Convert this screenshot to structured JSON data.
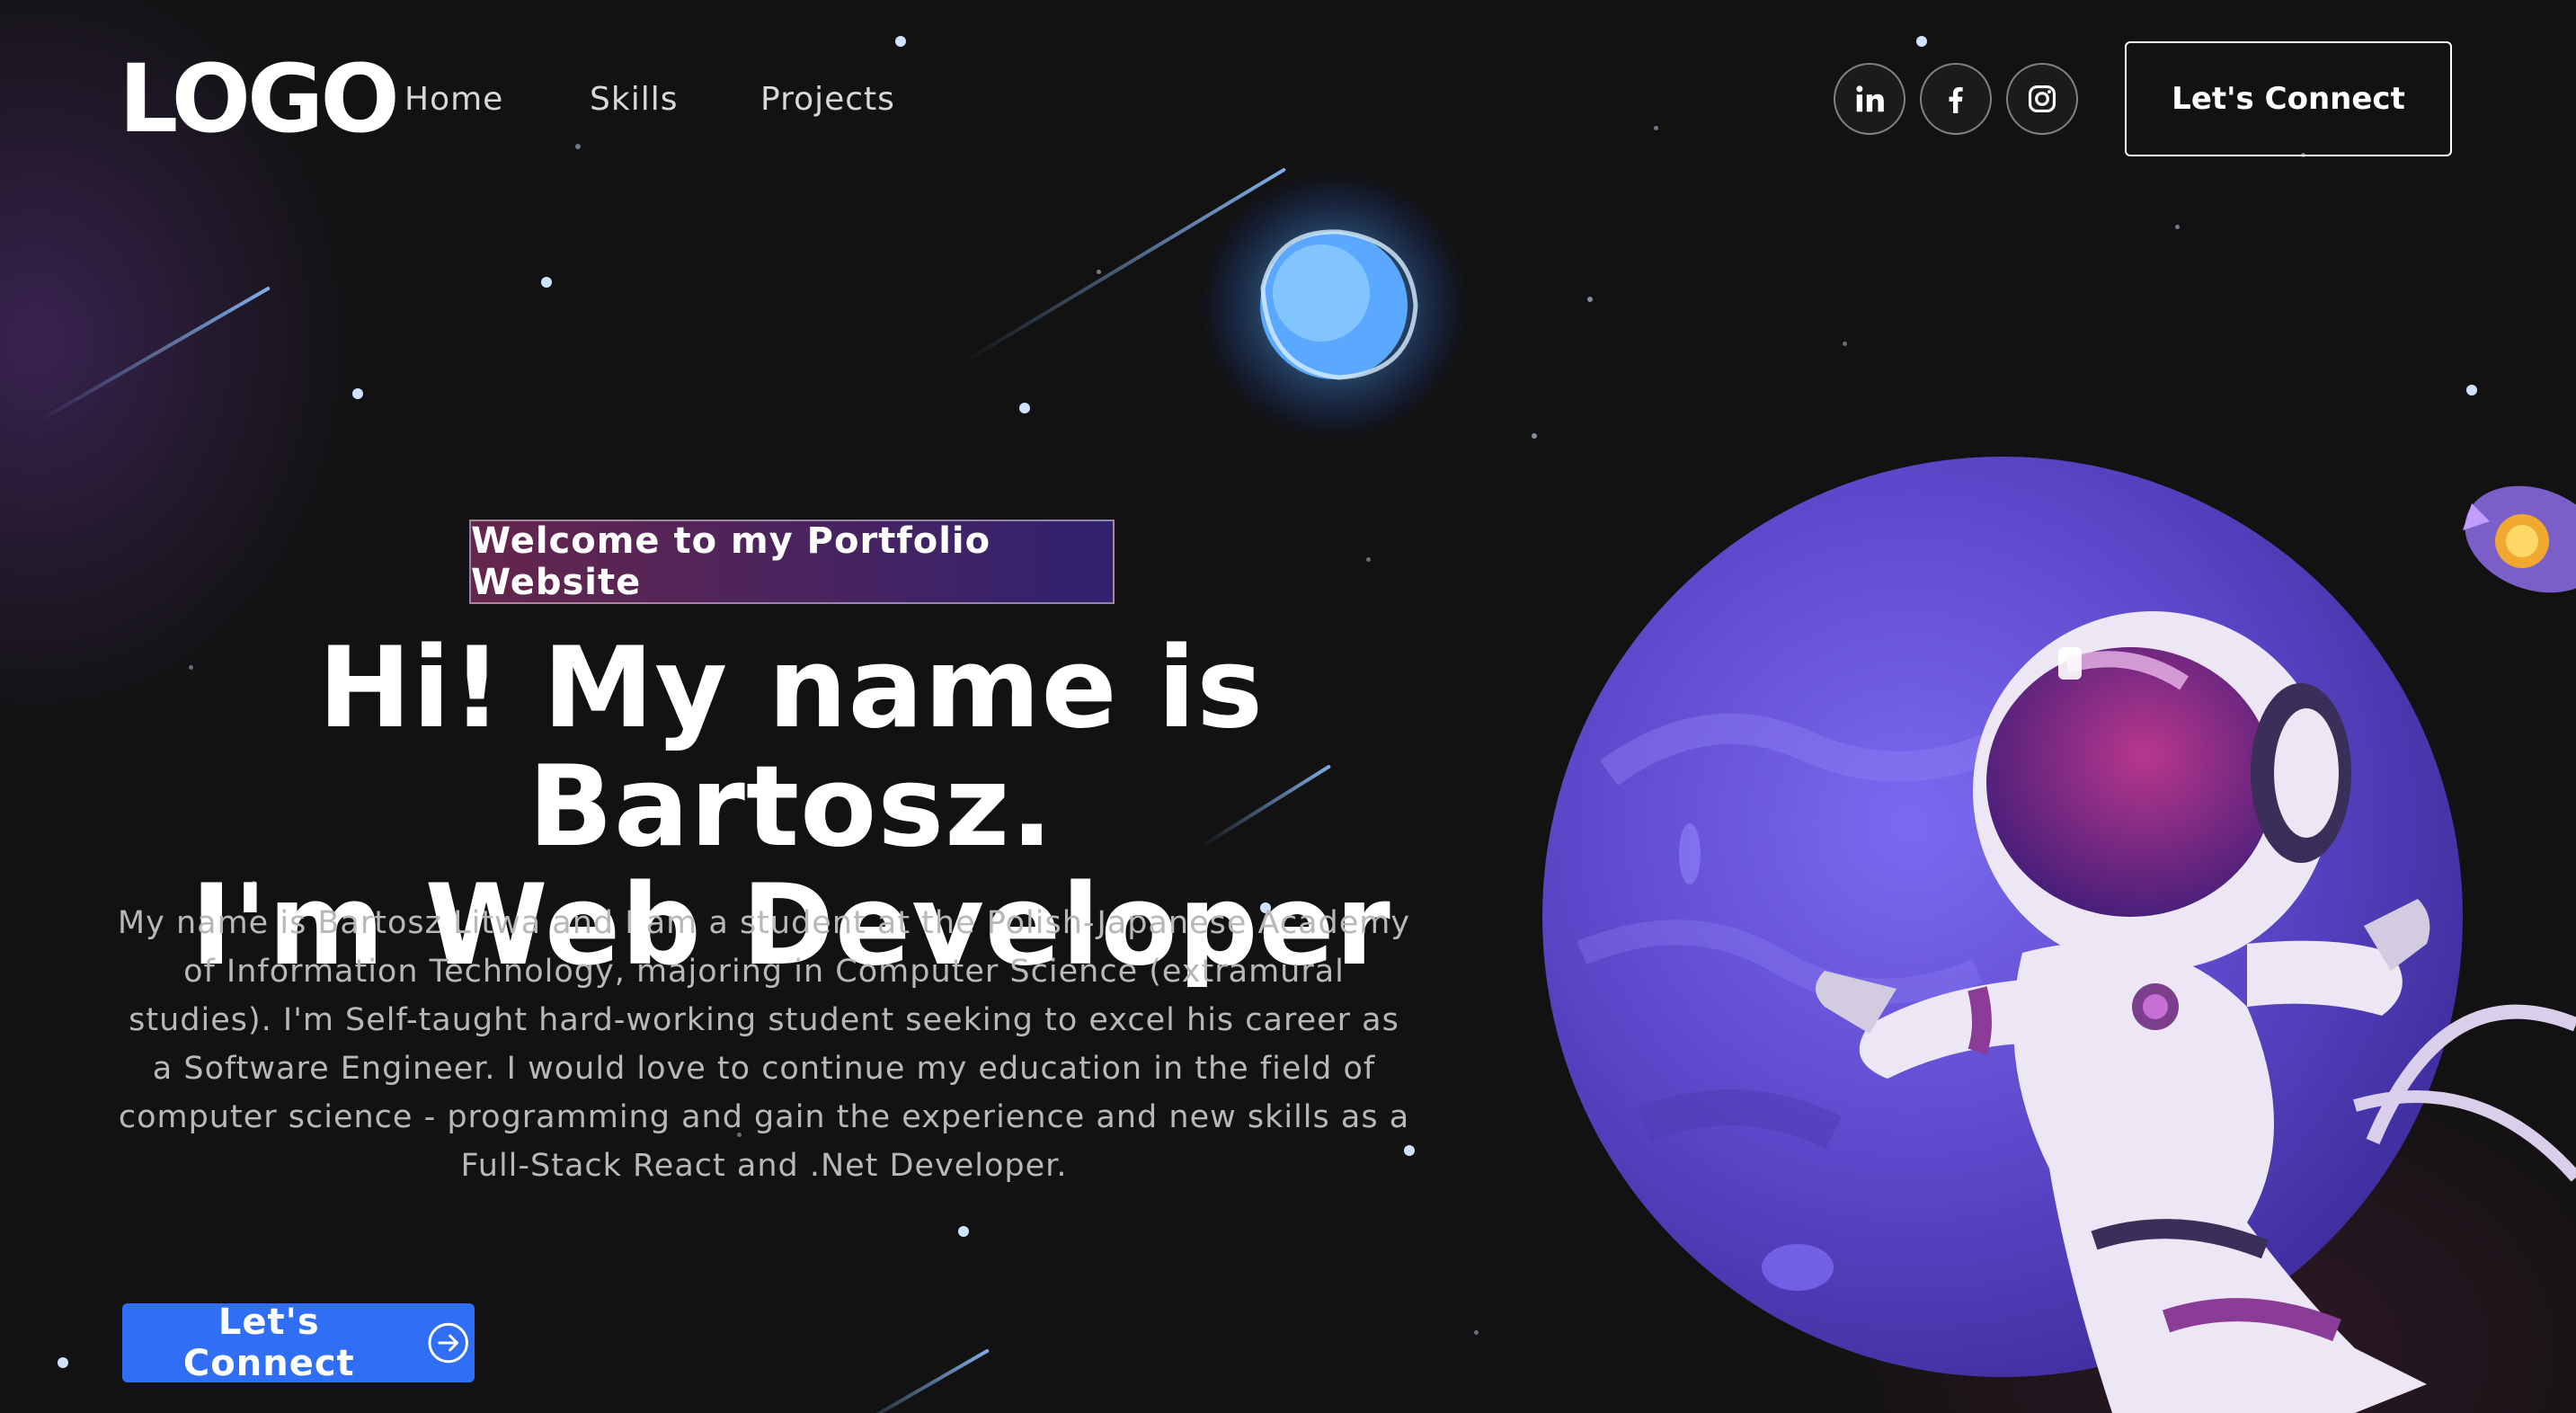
{
  "nav": {
    "logo": "LOGO",
    "links": [
      "Home",
      "Skills",
      "Projects"
    ],
    "social": [
      {
        "icon": "linkedin-icon",
        "label": "in"
      },
      {
        "icon": "facebook-icon",
        "label": "f"
      },
      {
        "icon": "instagram-icon",
        "label": ""
      }
    ],
    "connect_label": "Let's Connect"
  },
  "hero": {
    "tagline": "Welcome to my Portfolio Website",
    "headline_line1": "Hi! My name is Bartosz.",
    "headline_line2": "I'm Web Developer",
    "description": "My name is Bartosz Litwa and I am a student at the Polish-Japanese Academy of Information Technology, majoring in Computer Science (extramural studies). I'm Self-taught hard-working student seeking to excel his career as a Software Engineer. I would love to continue my education in the field of computer science - programming and gain the experience and new skills as a Full-Stack React and .Net Developer.",
    "cta_label": "Let's Connect",
    "cta_icon": "arrow-right-circle-icon"
  },
  "colors": {
    "background": "#121212",
    "accent_blue": "#2f6ef5",
    "planet_purple": "#5b46c8",
    "tagline_gradient_start": "#aa367c",
    "tagline_gradient_end": "#4a2fbd"
  }
}
